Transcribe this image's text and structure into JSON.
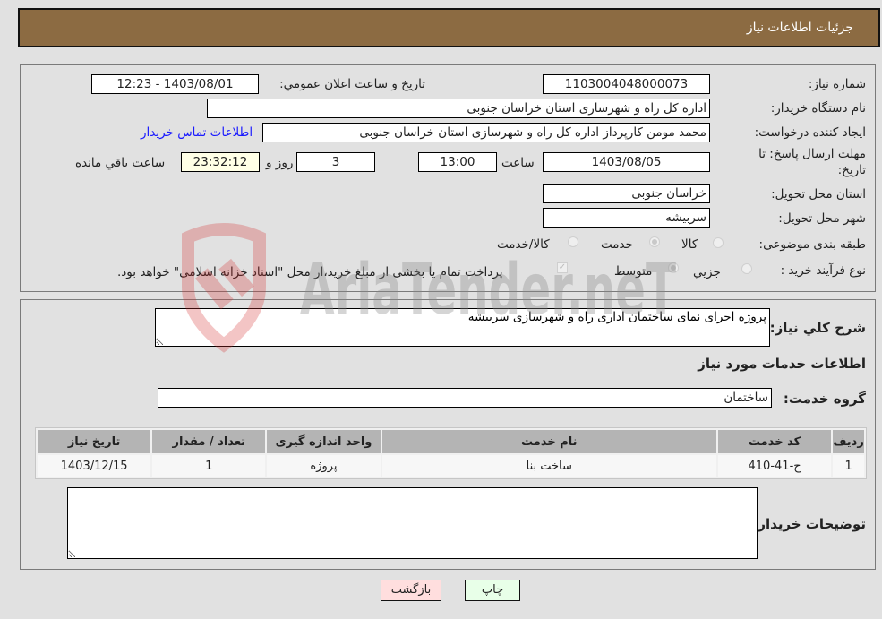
{
  "header": {
    "title": "جزئیات اطلاعات نیاز"
  },
  "details": {
    "need_number_label": "شماره نیاز:",
    "need_number": "1103004048000073",
    "announce_label": "تاریخ و ساعت اعلان عمومي:",
    "announce_value": "1403/08/01 - 12:23",
    "buyer_org_label": "نام دستگاه خریدار:",
    "buyer_org": "اداره کل راه و شهرسازی استان خراسان جنوبی",
    "creator_label": "ایجاد کننده درخواست:",
    "creator": "محمد مومن کارپرداز اداره کل راه و شهرسازی استان خراسان جنوبی",
    "contact_link": "اطلاعات تماس خریدار",
    "deadline_label_1": "مهلت ارسال پاسخ: تا",
    "deadline_label_2": "تاریخ:",
    "deadline_date": "1403/08/05",
    "time_label": "ساعت",
    "deadline_time": "13:00",
    "days_value": "3",
    "days_label": "روز و",
    "remaining_time": "23:32:12",
    "remaining_label": "ساعت باقي مانده",
    "province_label": "استان محل تحویل:",
    "province": "خراسان جنوبی",
    "city_label": "شهر محل تحویل:",
    "city": "سربیشه",
    "category_label": "طبقه بندی موضوعی:",
    "category_options": [
      {
        "label": "کالا",
        "selected": false
      },
      {
        "label": "خدمت",
        "selected": true
      },
      {
        "label": "کالا/خدمت",
        "selected": false
      }
    ],
    "process_label": "نوع فرآیند خرید :",
    "process_options": [
      {
        "label": "جزيي",
        "selected": false
      },
      {
        "label": "متوسط",
        "selected": true
      }
    ],
    "treasury_checked": true,
    "treasury_text": "پرداخت تمام یا بخشی از مبلغ خرید،از محل \"اسناد خزانه اسلامی\" خواهد بود."
  },
  "services": {
    "description_label": "شرح كلي نياز:",
    "description": "پروژه اجرای نمای ساختمان اداری راه و شهرسازی سربیشه",
    "section_title": "اطلاعات خدمات مورد نياز",
    "group_label": "گروه خدمت:",
    "group_value": "ساختمان",
    "table": {
      "headers": [
        "ردیف",
        "کد خدمت",
        "نام خدمت",
        "واحد اندازه گیری",
        "تعداد / مقدار",
        "تاریخ نیاز"
      ],
      "rows": [
        [
          "1",
          "ج-41-410",
          "ساخت بنا",
          "پروژه",
          "1",
          "1403/12/15"
        ]
      ]
    },
    "buyer_notes_label": "توضیحات خریدار:",
    "buyer_notes": ""
  },
  "buttons": {
    "print": "چاپ",
    "back": "بازگشت"
  },
  "watermark": {
    "text": "AriaTender.neT"
  }
}
